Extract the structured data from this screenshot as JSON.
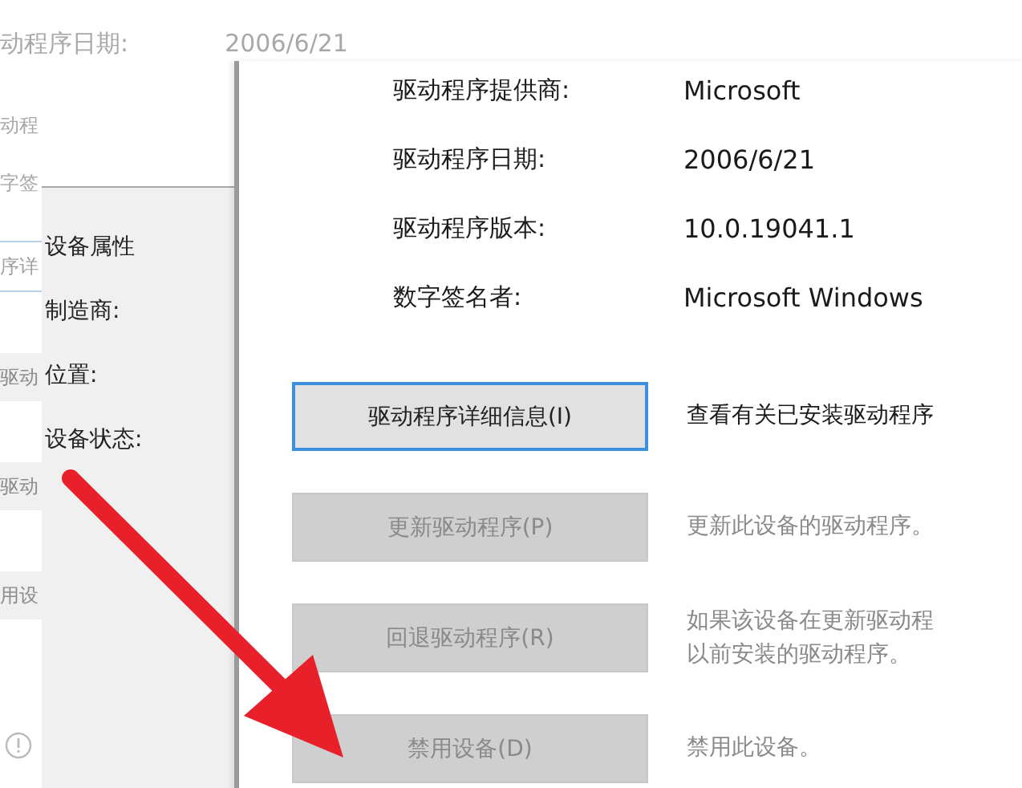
{
  "background_window": {
    "top_field": {
      "label": "动程序日期:",
      "value": "2006/6/21"
    },
    "side_texts": [
      {
        "kind": "text",
        "text": "动程"
      },
      {
        "kind": "text",
        "text": "字签"
      },
      {
        "kind": "button",
        "text": "序详",
        "focused": true
      },
      {
        "kind": "button",
        "text": "驱动",
        "focused": false
      },
      {
        "kind": "button",
        "text": "驱动",
        "focused": false
      },
      {
        "kind": "button",
        "text": "用设",
        "focused": false
      }
    ]
  },
  "device_panel": {
    "title": "设备属性",
    "labels": [
      "制造商:",
      "位置:",
      "设备状态:"
    ]
  },
  "driver_tab": {
    "fields": [
      {
        "label": "驱动程序提供商:",
        "value": "Microsoft"
      },
      {
        "label": "驱动程序日期:",
        "value": "2006/6/21"
      },
      {
        "label": "驱动程序版本:",
        "value": "10.0.19041.1"
      },
      {
        "label": "数字签名者:",
        "value": "Microsoft Windows"
      }
    ],
    "actions": [
      {
        "button": "驱动程序详细信息(I)",
        "description": [
          "查看有关已安装驱动程序"
        ],
        "disabled": false,
        "focused": true
      },
      {
        "button": "更新驱动程序(P)",
        "description": [
          "更新此设备的驱动程序。"
        ],
        "disabled": true,
        "focused": false
      },
      {
        "button": "回退驱动程序(R)",
        "description": [
          "如果该设备在更新驱动程",
          "以前安装的驱动程序。"
        ],
        "disabled": true,
        "focused": false
      },
      {
        "button": "禁用设备(D)",
        "description": [
          "禁用此设备。"
        ],
        "disabled": true,
        "focused": false
      }
    ]
  }
}
